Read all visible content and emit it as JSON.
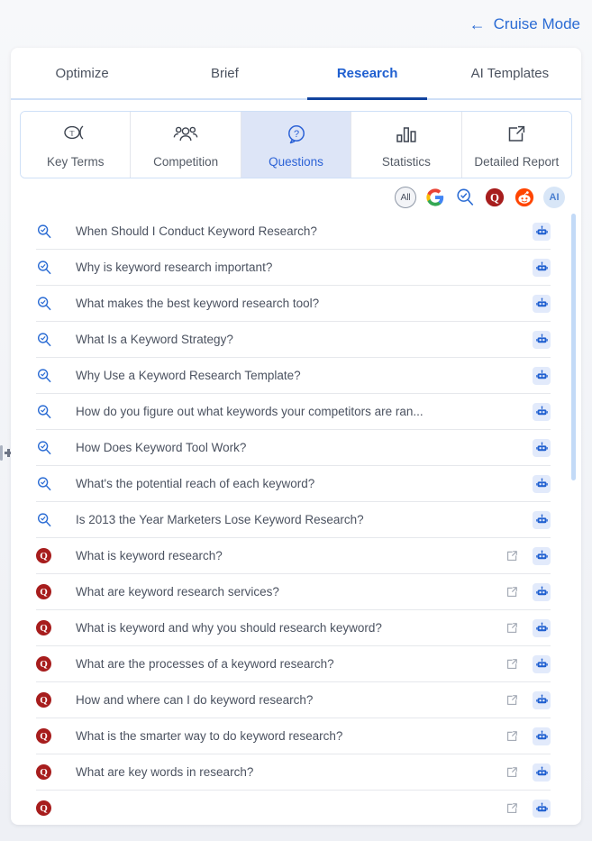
{
  "header": {
    "cruise_mode_label": "Cruise Mode",
    "back_arrow": "←",
    "accent_color": "#2b6cd4"
  },
  "main_tabs": [
    {
      "label": "Optimize",
      "active": false
    },
    {
      "label": "Brief",
      "active": false
    },
    {
      "label": "Research",
      "active": true
    },
    {
      "label": "AI Templates",
      "active": false
    }
  ],
  "sub_tabs": [
    {
      "label": "Key Terms",
      "icon": "key-terms-icon",
      "active": false
    },
    {
      "label": "Competition",
      "icon": "competition-icon",
      "active": false
    },
    {
      "label": "Questions",
      "icon": "question-bubble-icon",
      "active": true
    },
    {
      "label": "Statistics",
      "icon": "bar-chart-icon",
      "active": false
    },
    {
      "label": "Detailed Report",
      "icon": "external-link-icon",
      "active": false
    }
  ],
  "filters": [
    {
      "name": "all",
      "label": "All",
      "active": true
    },
    {
      "name": "google",
      "label": "",
      "active": false
    },
    {
      "name": "search",
      "label": "",
      "active": false
    },
    {
      "name": "quora",
      "label": "",
      "active": false
    },
    {
      "name": "reddit",
      "label": "",
      "active": false
    },
    {
      "name": "ai",
      "label": "AI",
      "active": false
    }
  ],
  "questions": [
    {
      "source": "search",
      "text": "When Should I Conduct Keyword Research?",
      "has_external_link": false
    },
    {
      "source": "search",
      "text": "Why is keyword research important?",
      "has_external_link": false
    },
    {
      "source": "search",
      "text": "What makes the best keyword research tool?",
      "has_external_link": false
    },
    {
      "source": "search",
      "text": "What Is a Keyword Strategy?",
      "has_external_link": false
    },
    {
      "source": "search",
      "text": "Why Use a Keyword Research Template?",
      "has_external_link": false
    },
    {
      "source": "search",
      "text": "How do you figure out what keywords your competitors are ran...",
      "has_external_link": false
    },
    {
      "source": "search",
      "text": "How Does Keyword Tool Work?",
      "has_external_link": false
    },
    {
      "source": "search",
      "text": "What's the potential reach of each keyword?",
      "has_external_link": false
    },
    {
      "source": "search",
      "text": "Is 2013 the Year Marketers Lose Keyword Research?",
      "has_external_link": false
    },
    {
      "source": "quora",
      "text": "What is keyword research?",
      "has_external_link": true
    },
    {
      "source": "quora",
      "text": "What are keyword research services?",
      "has_external_link": true
    },
    {
      "source": "quora",
      "text": "What is keyword and why you should research keyword?",
      "has_external_link": true
    },
    {
      "source": "quora",
      "text": "What are the processes of a keyword research?",
      "has_external_link": true
    },
    {
      "source": "quora",
      "text": "How and where can I do keyword research?",
      "has_external_link": true
    },
    {
      "source": "quora",
      "text": "What is the smarter way to do keyword research?",
      "has_external_link": true
    },
    {
      "source": "quora",
      "text": "What are key words in research?",
      "has_external_link": true
    },
    {
      "source": "quora",
      "text": "",
      "has_external_link": true
    }
  ],
  "colors": {
    "accent_blue": "#2b6cd4",
    "active_tab_underline": "#11439e",
    "subtab_active_bg": "#dde5f7",
    "quora_red": "#a71d1d",
    "bot_chip_bg": "#e2eafb",
    "scrollbar": "#c3daf7"
  }
}
